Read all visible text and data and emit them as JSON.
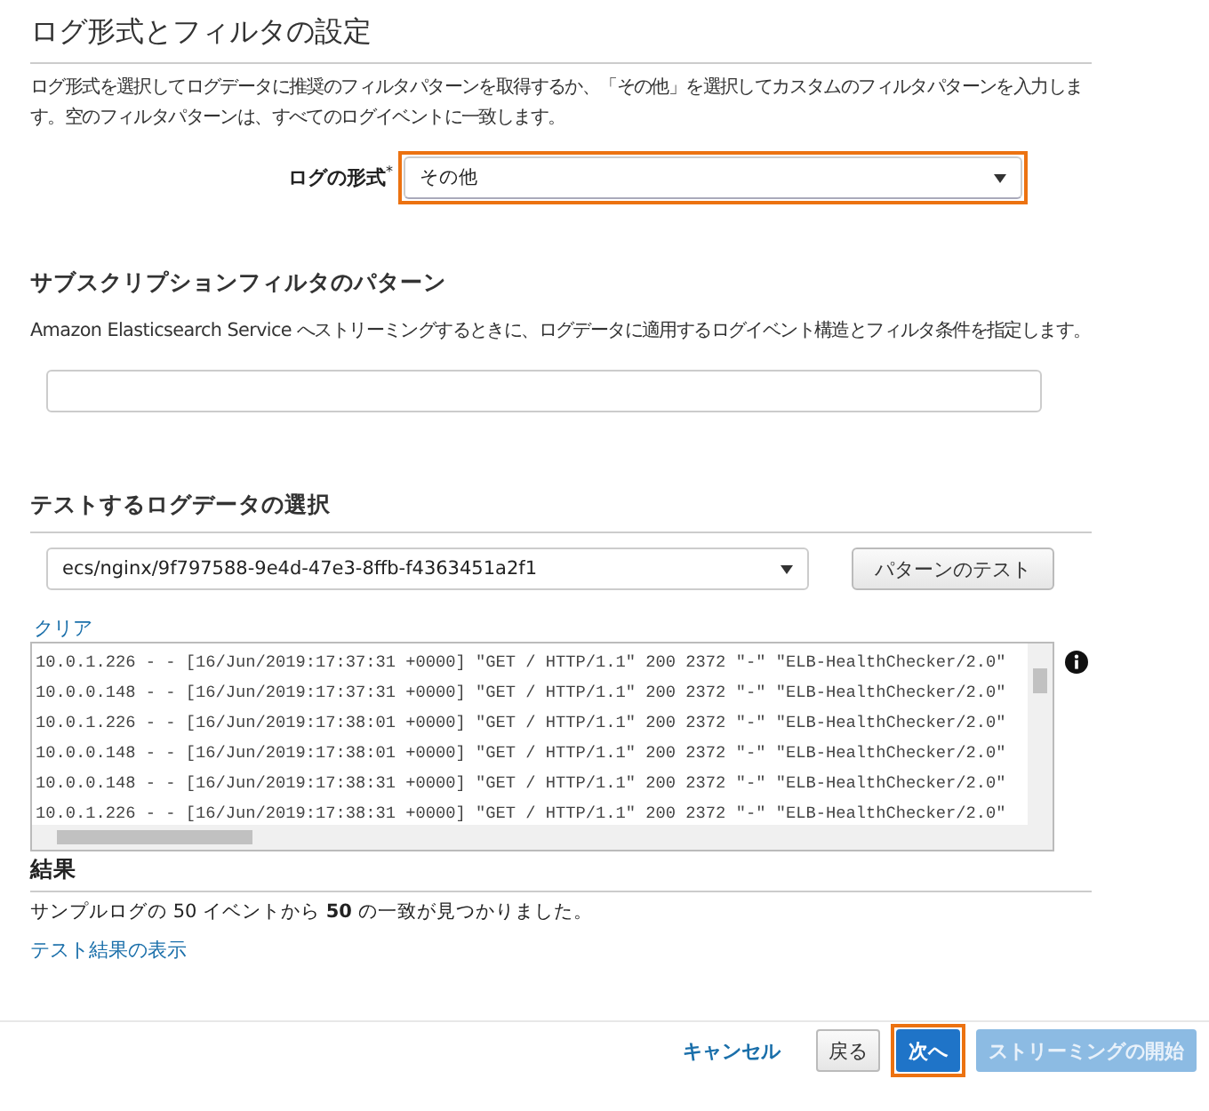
{
  "title": "ログ形式とフィルタの設定",
  "intro": "ログ形式を選択してログデータに推奨のフィルタパターンを取得するか、「その他」を選択してカスタムのフィルタパターンを入力します。空のフィルタパターンは、すべてのログイベントに一致します。",
  "log_format": {
    "label": "ログの形式",
    "required_mark": "*",
    "value": "その他",
    "highlighted": true
  },
  "pattern_section": {
    "heading": "サブスクリプションフィルタのパターン",
    "description": "Amazon Elasticsearch Service へストリーミングするときに、ログデータに適用するログイベント構造とフィルタ条件を指定します。"
  },
  "test_section": {
    "heading": "テストするログデータの選択",
    "stream": "ecs/nginx/9f797588-9e4d-47e3-8ffb-f4363451a2f1",
    "test_button": "パターンのテスト",
    "clear_link": "クリア",
    "log_lines": [
      "10.0.1.226 - - [16/Jun/2019:17:37:31 +0000] \"GET / HTTP/1.1\" 200 2372 \"-\" \"ELB-HealthChecker/2.0\"",
      "10.0.0.148 - - [16/Jun/2019:17:37:31 +0000] \"GET / HTTP/1.1\" 200 2372 \"-\" \"ELB-HealthChecker/2.0\"",
      "10.0.1.226 - - [16/Jun/2019:17:38:01 +0000] \"GET / HTTP/1.1\" 200 2372 \"-\" \"ELB-HealthChecker/2.0\"",
      "10.0.0.148 - - [16/Jun/2019:17:38:01 +0000] \"GET / HTTP/1.1\" 200 2372 \"-\" \"ELB-HealthChecker/2.0\"",
      "10.0.0.148 - - [16/Jun/2019:17:38:31 +0000] \"GET / HTTP/1.1\" 200 2372 \"-\" \"ELB-HealthChecker/2.0\"",
      "10.0.1.226 - - [16/Jun/2019:17:38:31 +0000] \"GET / HTTP/1.1\" 200 2372 \"-\" \"ELB-HealthChecker/2.0\""
    ]
  },
  "results": {
    "heading": "結果",
    "summary": "サンプルログの 50 イベントから **50** の一致が見つかりました。",
    "show_link": "テスト結果の表示"
  },
  "footer": [
    {
      "kind": "link",
      "label": "キャンセル",
      "disabled": false,
      "highlighted": false
    },
    {
      "kind": "default",
      "label": "戻る",
      "disabled": false,
      "highlighted": false
    },
    {
      "kind": "primary",
      "label": "次へ",
      "disabled": false,
      "highlighted": true
    },
    {
      "kind": "primary",
      "label": "ストリーミングの開始",
      "disabled": true,
      "highlighted": false
    }
  ]
}
